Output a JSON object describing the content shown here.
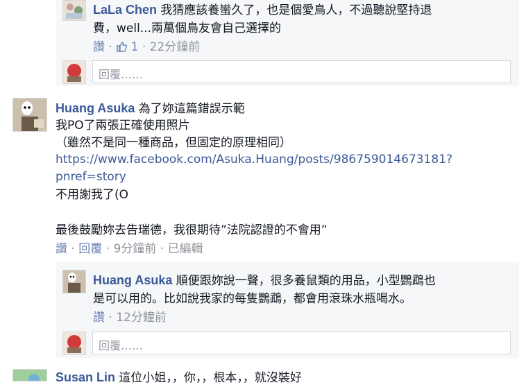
{
  "comments": [
    {
      "author": "LaLa Chen",
      "lines": [
        "我猜應該養蠻久了，也是個愛鳥人，不過聽說堅持退",
        "費，well...兩萬個鳥友會自己選擇的"
      ],
      "meta": {
        "like": "讚",
        "likes": "1",
        "time": "22分鐘前"
      },
      "reply_placeholder": "回覆……"
    },
    {
      "author": "Huang Asuka",
      "first_line": "為了妳這篇錯誤示範",
      "lines": [
        "我PO了兩張正確使用照片",
        "（雖然不是同一種商品，但固定的原理相同）"
      ],
      "link_lines": [
        "https://www.facebook.com/Asuka.Huang/posts/986759014673181?",
        "pnref=story"
      ],
      "after_link": "不用謝我了(O",
      "last_line": "最後鼓勵妳去告瑞德，我很期待”法院認證的不會用”",
      "meta": {
        "like": "讚",
        "reply": "回覆",
        "time": "9分鐘前",
        "edited": "已編輯"
      }
    },
    {
      "author": "Huang Asuka",
      "lines": [
        "順便跟妳說一聲，很多養鼠類的用品，小型鸚鵡也",
        "是可以用的。比如說我家的每隻鸚鵡，都會用滾珠水瓶喝水。"
      ],
      "meta": {
        "like": "讚",
        "time": "12分鐘前"
      },
      "reply_placeholder": "回覆……"
    },
    {
      "author": "Susan Lin",
      "first_line": "這位小姐，，你，，根本，，就沒裝好"
    }
  ],
  "separators": {
    "dot": "·"
  },
  "icons": [
    "thumbs-up-icon",
    "avatar-lala",
    "avatar-asuka",
    "avatar-user",
    "avatar-susan"
  ],
  "colors": {
    "name": "#3b5998",
    "panel": "#f6f7f9",
    "meta": "#6d84b4",
    "dim": "#90949c"
  }
}
